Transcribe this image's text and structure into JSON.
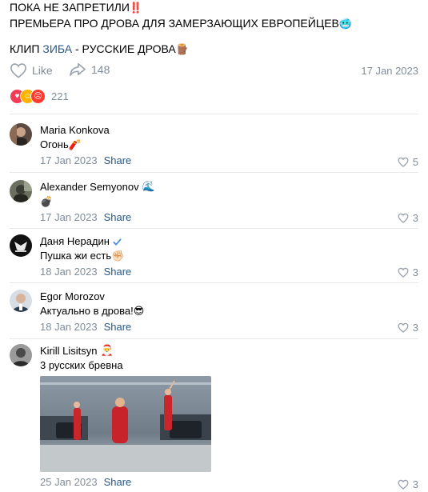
{
  "post": {
    "line1": "ПОКА НЕ ЗАПРЕТИЛИ",
    "line1_emoji": "‼️",
    "line2": "ПРЕМЬЕРА ПРО ДРОВА ДЛЯ ЗАМЕРЗАЮЩИХ ЕВРОПЕЙЦЕВ",
    "line2_emoji": "🥶",
    "line3_prefix": "КЛИП ",
    "line3_link": "ЗИБА",
    "line3_suffix": " - РУССКИЕ ДРОВА",
    "line3_emoji": "🪵"
  },
  "actions": {
    "like_label": "Like",
    "share_count": "148",
    "date": "17 Jan 2023"
  },
  "reactions": {
    "count": "221",
    "colors": [
      "#f23c56",
      "#ffb300",
      "#ff3b30"
    ]
  },
  "comments": [
    {
      "author": "Maria Konkova",
      "badge": "",
      "text": "Огонь",
      "text_emoji": "🧨",
      "date": "17 Jan 2023",
      "share_label": "Share",
      "likes": "5"
    },
    {
      "author": "Alexander Semyonov",
      "badge": "🌊",
      "text": "",
      "text_emoji": "💣",
      "date": "17 Jan 2023",
      "share_label": "Share",
      "likes": "3"
    },
    {
      "author": "Даня Нерадин",
      "badge": "verified",
      "text": "Пушка жи есть",
      "text_emoji": "✊🏻",
      "date": "18 Jan 2023",
      "share_label": "Share",
      "likes": "3"
    },
    {
      "author": "Egor Morozov",
      "badge": "",
      "text": "Актуально в дрова!",
      "text_emoji": "😎",
      "date": "18 Jan 2023",
      "share_label": "Share",
      "likes": "3"
    },
    {
      "author": "Kirill Lisitsyn",
      "badge": "🎅",
      "text": "3 русских бревна",
      "text_emoji": "",
      "date": "25 Jan 2023",
      "share_label": "Share",
      "likes": "3"
    }
  ],
  "colors": {
    "link": "#2a5885",
    "muted": "#818c99",
    "divider": "#e7e8ec",
    "verified": "#4a90d9"
  }
}
